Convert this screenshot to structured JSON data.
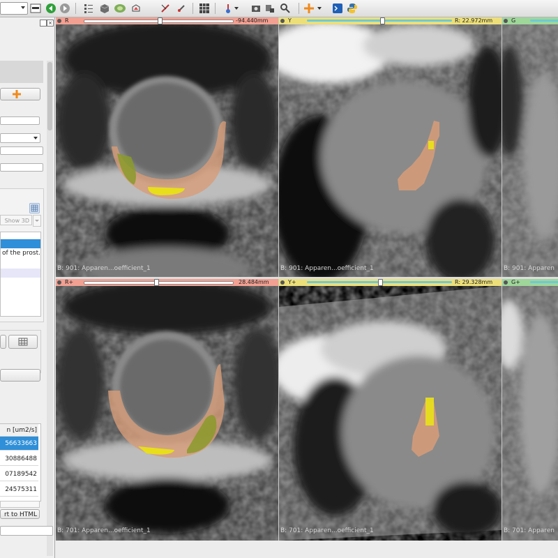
{
  "toolbar": {
    "icons": [
      "layout-icon",
      "back-icon",
      "forward-icon",
      "data-icon",
      "volume-icon",
      "models-icon",
      "segment-icon",
      "markups-icon",
      "crosshair-icon",
      "grid-icon",
      "fiducial-icon",
      "screenshot-icon",
      "scene-icon",
      "extension-icon",
      "place-icon",
      "python-icon"
    ]
  },
  "left_panel": {
    "show3d_label": "Show 3D",
    "segment_row_label": "of the prost...",
    "table_header": "n [um2/s]",
    "table_values": [
      "56633663",
      "30886488",
      "07189542",
      "24575311"
    ],
    "export_label": "rt to HTML"
  },
  "views": {
    "red_top": {
      "label": "R",
      "value": "-94.440mm",
      "footer": "B: 901: Apparen...oefficient_1"
    },
    "yellow_top": {
      "label": "Y",
      "value": "R: 22.972mm",
      "footer": "B: 901: Apparen...oefficient_1"
    },
    "green_top": {
      "label": "G",
      "footer": "B: 901: Apparen"
    },
    "red_bottom": {
      "label": "R+",
      "value": "28.484mm",
      "footer": "B: 701: Apparen...oefficient_1"
    },
    "yellow_bottom": {
      "label": "Y+",
      "value": "R: 29.328mm",
      "footer": "B: 701: Apparen...oefficient_1"
    },
    "green_bottom": {
      "label": "G+",
      "footer": "B: 701: Apparen"
    }
  },
  "colors": {
    "red_bar": "#f2a092",
    "yellow_bar": "#ecdf7a",
    "green_bar": "#9fd69a",
    "selection": "#2f8fd8",
    "segment_tissue": "#d79c78",
    "segment_lesion": "#e8de1c",
    "segment_zone": "#8a9a2a"
  }
}
